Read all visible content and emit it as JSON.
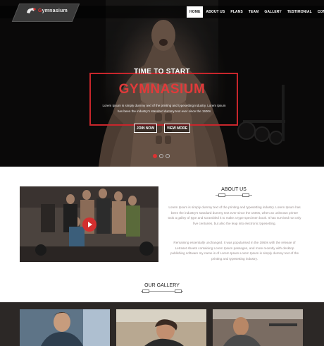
{
  "logo": {
    "text_pre": "G",
    "text_post": "ymnasium"
  },
  "nav": {
    "items": [
      {
        "label": "HOME",
        "active": true
      },
      {
        "label": "ABOUT US",
        "active": false
      },
      {
        "label": "PLANS",
        "active": false
      },
      {
        "label": "TEAM",
        "active": false
      },
      {
        "label": "GALLERY",
        "active": false
      },
      {
        "label": "TESTIMONIAL",
        "active": false
      },
      {
        "label": "CONTACT",
        "active": false
      }
    ]
  },
  "hero": {
    "kicker": "TIME TO START",
    "title": "GYMNASIUM",
    "description": "Lorem Ipsum is simply dummy text of the printing and typesetting industry. Lorem Ipsum has been the industry's standard dummy text ever since the 1500s",
    "join_label": "JOIN NOW",
    "view_label": "VIEW MORE",
    "slides": 3,
    "active_slide": 1
  },
  "about": {
    "title": "ABOUT US",
    "paragraph1": "Lorem Ipsum is simply dummy text of the printing and typesetting industry. Lorem Ipsum has been the industry's standard dummy text ever since the 1500s, when an unknown printer took a galley of type and scrambled it to make a type specimen book. It has survived not only five centuries, but also the leap into electronic typesetting.",
    "paragraph2": "Remaining essentially unchanged. It was popularised in the 1960s with the release of Letraset sheets containing Lorem Ipsum passages, and more recently with desktop publishing software my name is of Lorem Ipsum.Lorem Ipsum is simply dummy text of the printing and typesetting industry."
  },
  "gallery": {
    "title": "OUR GALLERY"
  },
  "colors": {
    "accent": "#d32f2f",
    "dark": "#0d0c0b"
  }
}
